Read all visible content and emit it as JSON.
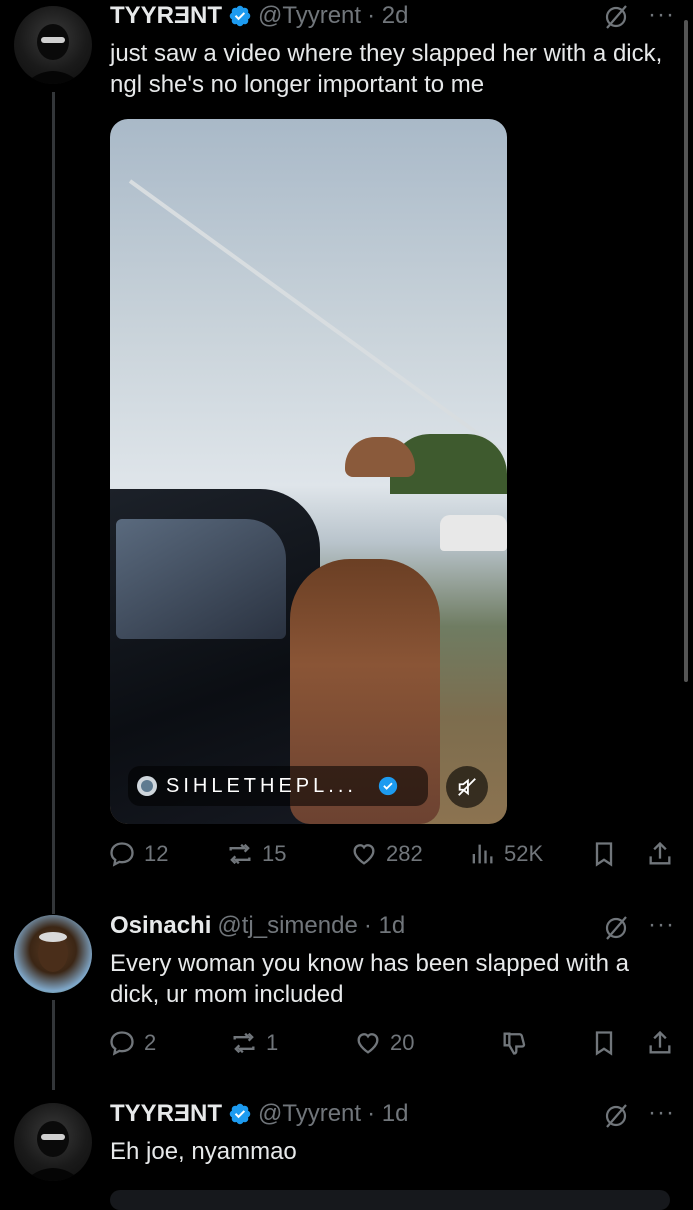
{
  "colors": {
    "accent": "#1d9bf0",
    "muted": "#71767b",
    "text": "#e7e9ea",
    "background": "#000000"
  },
  "tweets": [
    {
      "name": "TYYRƎNT",
      "handle": "@Tyyrent",
      "time": "· 2d",
      "text": "just saw a video where they slapped her with a dick, ngl she's no longer important to me",
      "media": {
        "attribution": "SIHLETHEPL...",
        "icon_name": "mute-icon"
      },
      "actions": {
        "replies": "12",
        "reposts": "15",
        "likes": "282",
        "views": "52K"
      }
    },
    {
      "name": "Osinachi",
      "handle": "@tj_simende",
      "time": "· 1d",
      "text": "Every woman you know has been slapped with a dick, ur mom included",
      "actions": {
        "replies": "2",
        "reposts": "1",
        "likes": "20"
      }
    },
    {
      "name": "TYYRƎNT",
      "handle": "@Tyyrent",
      "time": "· 1d",
      "text": "Eh joe, nyammao"
    }
  ]
}
